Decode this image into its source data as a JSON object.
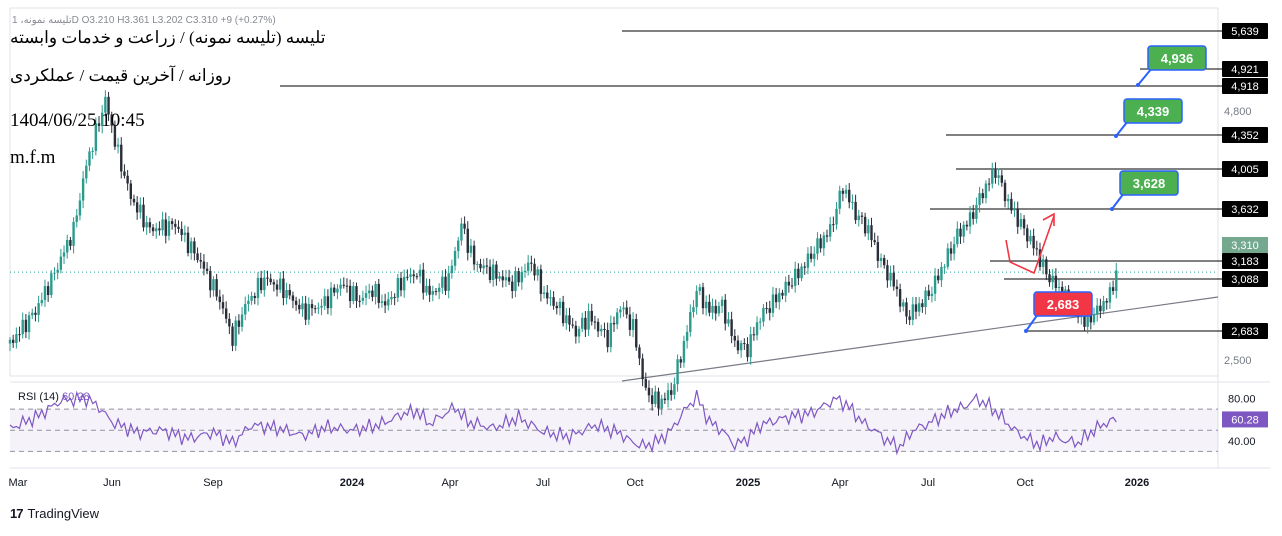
{
  "overlay": {
    "line1": "تلیسه (تلیسه نمونه) / زراعت و خدمات وابسته",
    "line2": "روزانه / آخرین قیمت / عملکردی",
    "timestamp": "1404/06/25 10:45",
    "signature": "m.f.m"
  },
  "legend_top": "تلیسه نمونه، 1D  O3.210  H3.361  L3.202  C3.310  +9 (+0.27%)",
  "rsi_legend": {
    "name": "RSI (14)",
    "value": "60.28"
  },
  "footer": {
    "brand": "TradingView",
    "logo": "17"
  },
  "colors": {
    "up": "#26a69a",
    "down": "#ef5350",
    "candle": "#363a45",
    "rsi": "#7e57c2",
    "green_badge": "#4caf50",
    "red_badge": "#f23645",
    "blue_border": "#2962ff",
    "price_tag": "#000000",
    "last_price_tag": "#74a98f"
  },
  "chart_data": {
    "type": "candlestick",
    "x_ticks": [
      "Mar",
      "Jun",
      "Sep",
      "2024",
      "Apr",
      "Jul",
      "Oct",
      "2025",
      "Apr",
      "Jul",
      "Oct",
      "2026"
    ],
    "y_ticks": [
      2500,
      4800
    ],
    "last_price": 3310,
    "close_series": [
      [
        0,
        2650
      ],
      [
        4,
        2950
      ],
      [
        7,
        3300
      ],
      [
        10,
        3700
      ],
      [
        12,
        4300
      ],
      [
        14,
        4700
      ],
      [
        15,
        4900
      ],
      [
        17,
        4400
      ],
      [
        19,
        4000
      ],
      [
        22,
        3700
      ],
      [
        26,
        3750
      ],
      [
        30,
        3400
      ],
      [
        33,
        3050
      ],
      [
        35,
        2700
      ],
      [
        37,
        3000
      ],
      [
        40,
        3250
      ],
      [
        43,
        3150
      ],
      [
        46,
        2950
      ],
      [
        49,
        3000
      ],
      [
        52,
        3200
      ],
      [
        55,
        3050
      ],
      [
        57,
        3150
      ],
      [
        59,
        3000
      ],
      [
        62,
        3250
      ],
      [
        64,
        3300
      ],
      [
        66,
        3100
      ],
      [
        69,
        3250
      ],
      [
        71,
        3750
      ],
      [
        73,
        3400
      ],
      [
        76,
        3300
      ],
      [
        79,
        3200
      ],
      [
        82,
        3400
      ],
      [
        84,
        3100
      ],
      [
        86,
        3000
      ],
      [
        89,
        2750
      ],
      [
        91,
        2900
      ],
      [
        94,
        2700
      ],
      [
        96,
        3000
      ],
      [
        98,
        2800
      ],
      [
        100,
        2200
      ],
      [
        102,
        2100
      ],
      [
        104,
        2200
      ],
      [
        106,
        2650
      ],
      [
        108,
        3150
      ],
      [
        110,
        2950
      ],
      [
        112,
        3000
      ],
      [
        114,
        2650
      ],
      [
        116,
        2600
      ],
      [
        118,
        2900
      ],
      [
        121,
        3100
      ],
      [
        124,
        3300
      ],
      [
        127,
        3550
      ],
      [
        129,
        3700
      ],
      [
        131,
        4100
      ],
      [
        133,
        3850
      ],
      [
        135,
        3700
      ],
      [
        137,
        3400
      ],
      [
        139,
        3200
      ],
      [
        141,
        2900
      ],
      [
        143,
        3000
      ],
      [
        145,
        3150
      ],
      [
        147,
        3400
      ],
      [
        149,
        3650
      ],
      [
        151,
        3800
      ],
      [
        153,
        4050
      ],
      [
        155,
        4250
      ],
      [
        157,
        3950
      ],
      [
        159,
        3750
      ],
      [
        161,
        3550
      ],
      [
        163,
        3300
      ],
      [
        165,
        3150
      ],
      [
        167,
        3000
      ],
      [
        169,
        2850
      ],
      [
        171,
        2950
      ],
      [
        173,
        3100
      ],
      [
        174,
        3310
      ]
    ],
    "rsi_series": [
      [
        0,
        52
      ],
      [
        4,
        62
      ],
      [
        8,
        78
      ],
      [
        12,
        80
      ],
      [
        14,
        72
      ],
      [
        16,
        58
      ],
      [
        20,
        48
      ],
      [
        24,
        50
      ],
      [
        28,
        42
      ],
      [
        32,
        48
      ],
      [
        35,
        38
      ],
      [
        38,
        55
      ],
      [
        42,
        52
      ],
      [
        46,
        45
      ],
      [
        50,
        53
      ],
      [
        54,
        50
      ],
      [
        58,
        55
      ],
      [
        62,
        66
      ],
      [
        64,
        68
      ],
      [
        66,
        56
      ],
      [
        70,
        72
      ],
      [
        72,
        58
      ],
      [
        76,
        52
      ],
      [
        80,
        62
      ],
      [
        84,
        48
      ],
      [
        88,
        44
      ],
      [
        92,
        55
      ],
      [
        96,
        47
      ],
      [
        98,
        38
      ],
      [
        100,
        35
      ],
      [
        102,
        40
      ],
      [
        104,
        50
      ],
      [
        106,
        68
      ],
      [
        108,
        82
      ],
      [
        110,
        58
      ],
      [
        112,
        50
      ],
      [
        114,
        36
      ],
      [
        116,
        42
      ],
      [
        118,
        55
      ],
      [
        122,
        62
      ],
      [
        126,
        66
      ],
      [
        130,
        80
      ],
      [
        132,
        72
      ],
      [
        134,
        58
      ],
      [
        136,
        50
      ],
      [
        138,
        40
      ],
      [
        140,
        34
      ],
      [
        142,
        50
      ],
      [
        144,
        55
      ],
      [
        148,
        68
      ],
      [
        150,
        72
      ],
      [
        152,
        80
      ],
      [
        154,
        73
      ],
      [
        156,
        62
      ],
      [
        158,
        50
      ],
      [
        160,
        42
      ],
      [
        162,
        36
      ],
      [
        164,
        44
      ],
      [
        166,
        40
      ],
      [
        168,
        38
      ],
      [
        170,
        48
      ],
      [
        172,
        56
      ],
      [
        174,
        60.28
      ]
    ],
    "rsi": {
      "value": 60.28,
      "upper": 70,
      "mid": 50,
      "lower": 30,
      "ticks": [
        80,
        40
      ]
    },
    "horizontal_levels": [
      {
        "label": "5,639",
        "value": 5639
      },
      {
        "label": "4,921",
        "value": 4921
      },
      {
        "label": "4,918",
        "value": 4918
      },
      {
        "label": "4,352",
        "value": 4352
      },
      {
        "label": "4,005",
        "value": 4005
      },
      {
        "label": "3,632",
        "value": 3632
      },
      {
        "label": "3,183",
        "value": 3183
      },
      {
        "label": "3,088",
        "value": 3088
      },
      {
        "label": "2,683",
        "value": 2683
      }
    ],
    "targets": [
      {
        "label": "4,936",
        "value": 4936,
        "kind": "green"
      },
      {
        "label": "4,339",
        "value": 4339,
        "kind": "green"
      },
      {
        "label": "3,628",
        "value": 3628,
        "kind": "green"
      },
      {
        "label": "2,683",
        "value": 2683,
        "kind": "red"
      }
    ],
    "trendline": {
      "from": [
        102,
        2100
      ],
      "to": [
        180,
        2920
      ]
    },
    "projection": [
      [
        174,
        3310
      ],
      [
        176,
        3120
      ],
      [
        178,
        3050
      ],
      [
        181,
        3600
      ]
    ]
  }
}
